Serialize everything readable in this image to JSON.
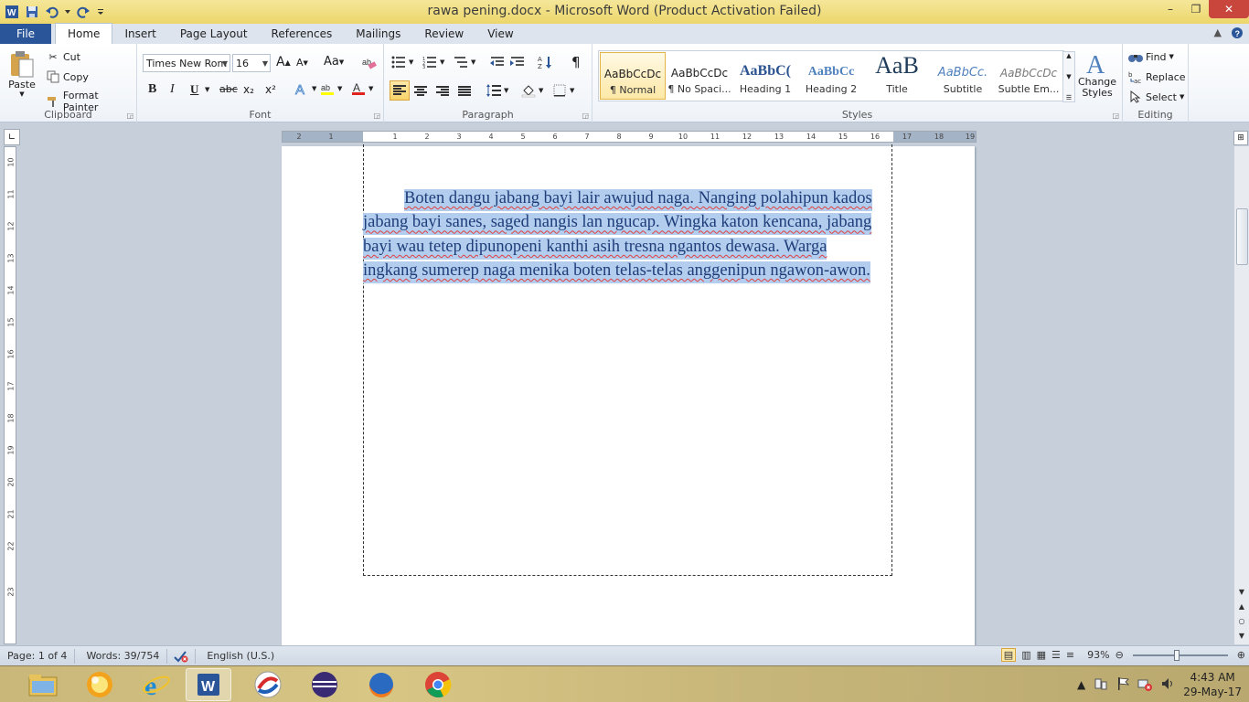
{
  "window": {
    "title": "rawa pening.docx  -  Microsoft Word (Product Activation Failed)",
    "app_icon": "word-icon",
    "controls": {
      "minimize": "–",
      "maximize": "❐",
      "close": "✕"
    }
  },
  "tabs": [
    {
      "label": "File"
    },
    {
      "label": "Home"
    },
    {
      "label": "Insert"
    },
    {
      "label": "Page Layout"
    },
    {
      "label": "References"
    },
    {
      "label": "Mailings"
    },
    {
      "label": "Review"
    },
    {
      "label": "View"
    }
  ],
  "active_tab": "Home",
  "clipboard": {
    "paste": "Paste",
    "cut": "Cut",
    "copy": "Copy",
    "format_painter": "Format Painter",
    "label": "Clipboard"
  },
  "font": {
    "family": "Times New Rom",
    "size": "16",
    "label": "Font",
    "grow": "A",
    "shrink": "A",
    "change_case": "Aa",
    "bold": "B",
    "italic": "I",
    "underline": "U",
    "strike": "abc",
    "sub": "x₂",
    "sup": "x²"
  },
  "paragraph": {
    "label": "Paragraph",
    "pilcrow": "¶"
  },
  "styles": {
    "label": "Styles",
    "items": [
      {
        "preview": "AaBbCcDc",
        "name": "¶ Normal"
      },
      {
        "preview": "AaBbCcDc",
        "name": "¶ No Spaci..."
      },
      {
        "preview": "AaBbC(",
        "name": "Heading 1"
      },
      {
        "preview": "AaBbCc",
        "name": "Heading 2"
      },
      {
        "preview": "AaB",
        "name": "Title"
      },
      {
        "preview": "AaBbCc.",
        "name": "Subtitle"
      },
      {
        "preview": "AaBbCcDc",
        "name": "Subtle Em..."
      }
    ],
    "change_styles": "Change Styles"
  },
  "editing": {
    "label": "Editing",
    "find": "Find",
    "replace": "Replace",
    "select": "Select"
  },
  "ruler": {
    "h_ticks": [
      "2",
      "1",
      "1",
      "2",
      "3",
      "4",
      "5",
      "6",
      "7",
      "8",
      "9",
      "10",
      "11",
      "12",
      "13",
      "14",
      "15",
      "16",
      "17",
      "18",
      "19"
    ],
    "v_ticks": [
      "10",
      "11",
      "12",
      "13",
      "14",
      "15",
      "16",
      "17",
      "18",
      "19",
      "20",
      "21",
      "22",
      "23"
    ]
  },
  "document": {
    "paragraph": "Boten dangu jabang bayi lair awujud naga. Nanging polahipun kados jabang bayi sanes, saged nangis lan ngucap. Wingka katon kencana, jabang bayi wau tetep dipunopeni kanthi asih tresna ngantos dewasa. Warga ingkang sumerep naga menika boten telas-telas anggenipun ngawon-awon."
  },
  "status": {
    "page": "Page: 1 of 4",
    "words": "Words: 39/754",
    "language": "English (U.S.)",
    "zoom": "93%",
    "zoom_value": 93
  },
  "taskbar": {
    "apps": [
      "file-explorer-icon",
      "media-player-icon",
      "internet-explorer-icon",
      "word-icon",
      "browser-icon",
      "eclipse-icon",
      "firefox-icon",
      "chrome-icon"
    ],
    "time": "4:43 AM",
    "date": "29-May-17"
  },
  "colors": {
    "accent": "#2a5699",
    "selection": "#b3cdee",
    "title_bar": "#ecd66b"
  }
}
